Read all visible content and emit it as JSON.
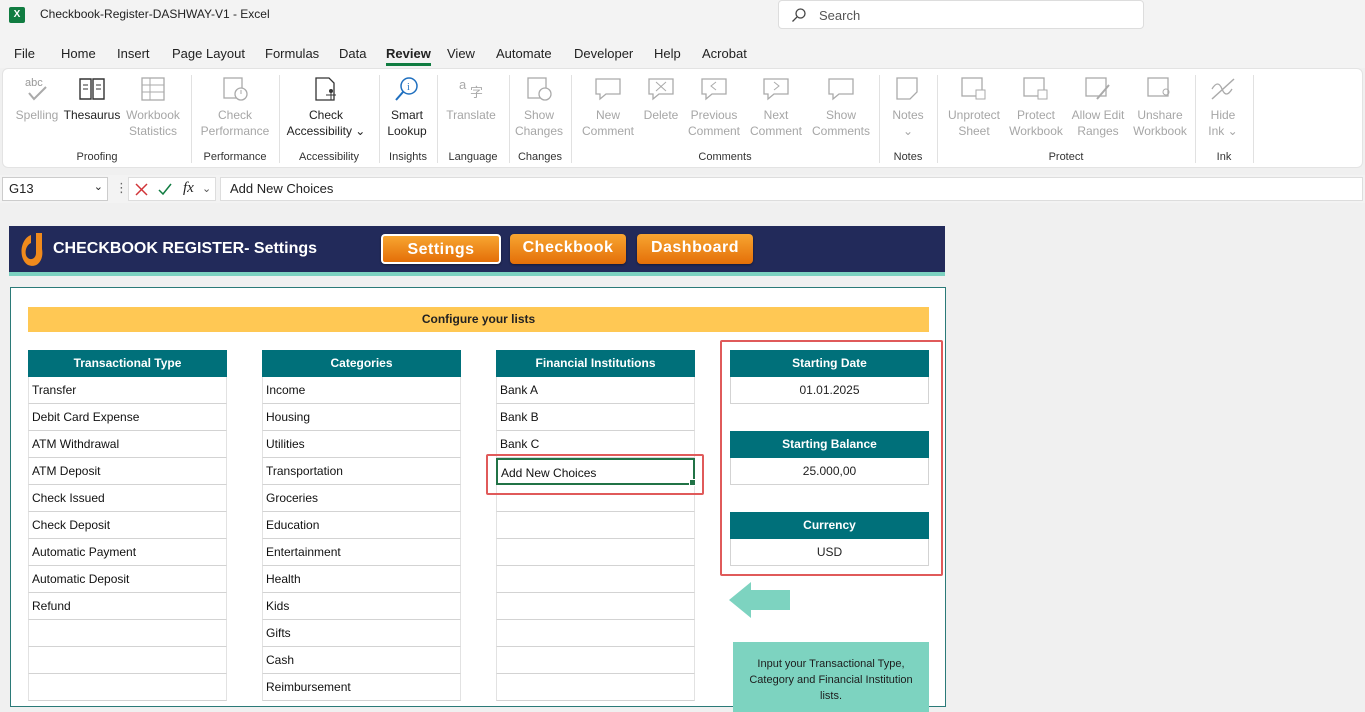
{
  "window": {
    "app_icon": "X",
    "title": "Checkbook-Register-DASHWAY-V1  -  Excel",
    "search_placeholder": "Search"
  },
  "menu": [
    {
      "label": "File"
    },
    {
      "label": "Home"
    },
    {
      "label": "Insert"
    },
    {
      "label": "Page Layout"
    },
    {
      "label": "Formulas"
    },
    {
      "label": "Data"
    },
    {
      "label": "Review",
      "active": true
    },
    {
      "label": "View"
    },
    {
      "label": "Automate"
    },
    {
      "label": "Developer"
    },
    {
      "label": "Help"
    },
    {
      "label": "Acrobat"
    }
  ],
  "ribbon": {
    "spelling": "Spelling",
    "thesaurus": "Thesaurus",
    "workbook_statistics": "Workbook Statistics",
    "check_performance": "Check Performance",
    "check_accessibility": "Check Accessibility ⌄",
    "smart_lookup": "Smart Lookup",
    "translate": "Translate",
    "show_changes": "Show Changes",
    "new_comment": "New Comment",
    "delete": "Delete",
    "previous_comment": "Previous Comment",
    "next_comment": "Next Comment",
    "show_comments": "Show Comments",
    "notes": "Notes",
    "unprotect_sheet": "Unprotect Sheet",
    "protect_workbook": "Protect Workbook",
    "allow_edit_ranges": "Allow Edit Ranges",
    "unshare_workbook": "Unshare Workbook",
    "hide_ink": "Hide Ink ⌄",
    "groups": {
      "proofing": "Proofing",
      "performance": "Performance",
      "accessibility": "Accessibility",
      "insights": "Insights",
      "language": "Language",
      "changes": "Changes",
      "comments": "Comments",
      "notes": "Notes",
      "protect": "Protect",
      "ink": "Ink"
    }
  },
  "formula_bar": {
    "cell_ref": "G13",
    "formula": "Add New Choices",
    "fx": "fx"
  },
  "banner": {
    "title": "CHECKBOOK REGISTER- Settings",
    "btn_settings": "Settings",
    "btn_checkbook": "Checkbook",
    "btn_dashboard": "Dashboard"
  },
  "config_title": "Configure your lists",
  "lists": {
    "transactional_type": {
      "header": "Transactional Type",
      "items": [
        "Transfer",
        "Debit Card Expense",
        "ATM Withdrawal",
        "ATM Deposit",
        "Check Issued",
        "Check Deposit",
        "Automatic Payment",
        "Automatic Deposit",
        "Refund",
        "",
        "",
        ""
      ]
    },
    "categories": {
      "header": "Categories",
      "items": [
        "Income",
        "Housing",
        "Utilities",
        "Transportation",
        "Groceries",
        "Education",
        "Entertainment",
        "Health",
        "Kids",
        "Gifts",
        "Cash",
        "Reimbursement"
      ]
    },
    "financial_institutions": {
      "header": "Financial Institutions",
      "items": [
        "Bank A",
        "Bank B",
        "Bank C",
        "Add New Choices",
        "",
        "",
        "",
        "",
        "",
        "",
        "",
        ""
      ]
    }
  },
  "settings": {
    "starting_date_label": "Starting Date",
    "starting_date": "01.01.2025",
    "starting_balance_label": "Starting Balance",
    "starting_balance": "25.000,00",
    "currency_label": "Currency",
    "currency": "USD"
  },
  "note": "Input your Transactional Type, Category and Financial Institution lists.",
  "colors": {
    "teal_header": "#00707a",
    "banner": "#222a5a",
    "config_bar": "#ffc854",
    "nav_button": "#f08a1c",
    "highlight": "#e05a5a",
    "note": "#7dd3c0"
  }
}
